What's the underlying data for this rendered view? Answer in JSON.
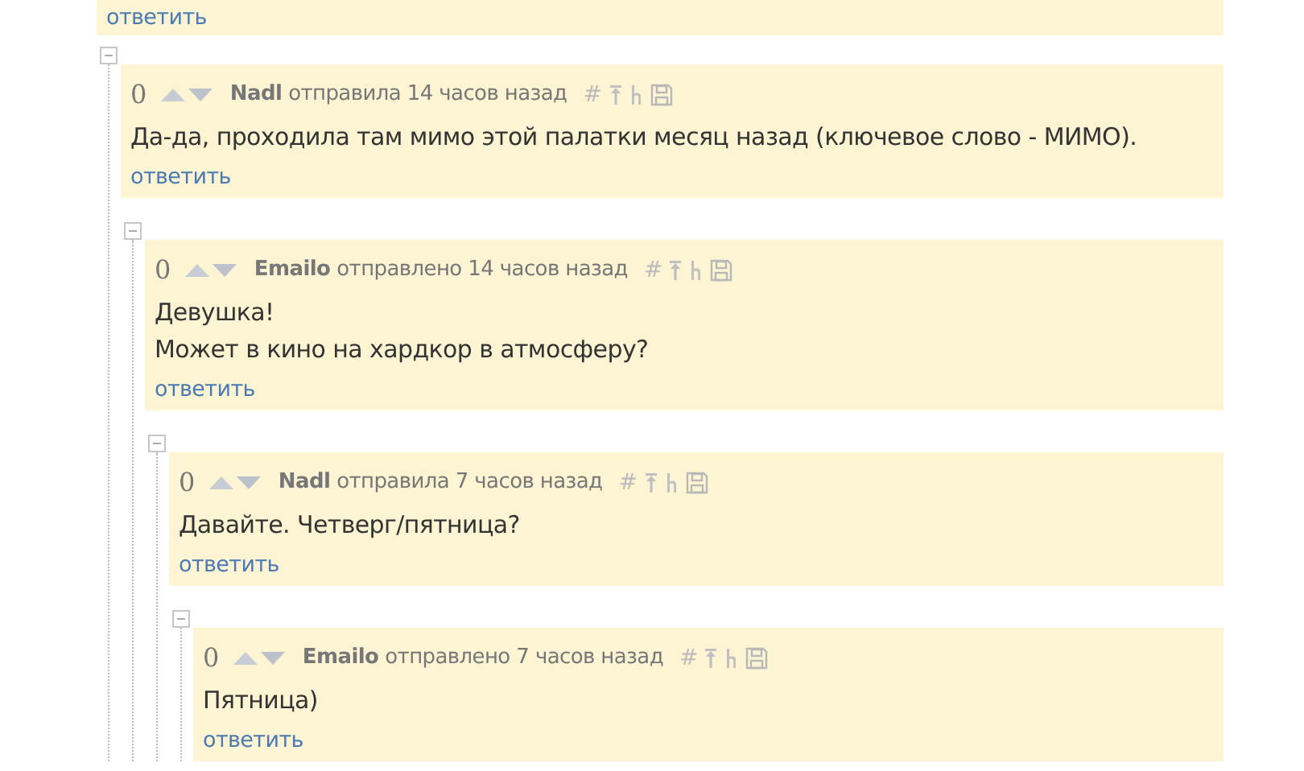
{
  "top_comment": {
    "reply_link": "ответить"
  },
  "comments": [
    {
      "expanded": true,
      "score": "0",
      "author": "Nadl",
      "action": "отправила",
      "time": "14 часов назад",
      "permalink": "#",
      "text": [
        "Да-да, проходила там мимо этой палатки месяц назад (ключевое слово - МИМО)."
      ],
      "reply_link": "ответить",
      "children": [
        {
          "expanded": true,
          "score": "0",
          "author": "Emailo",
          "action": "отправлено",
          "time": "14 часов назад",
          "permalink": "#",
          "text": [
            "Девушка!",
            "Может в кино на хардкор в атмосферу?"
          ],
          "reply_link": "ответить",
          "children": [
            {
              "expanded": true,
              "score": "0",
              "author": "Nadl",
              "action": "отправила",
              "time": "7 часов назад",
              "permalink": "#",
              "text": [
                "Давайте. Четверг/пятница?"
              ],
              "reply_link": "ответить",
              "children": [
                {
                  "expanded": true,
                  "score": "0",
                  "author": "Emailo",
                  "action": "отправлено",
                  "time": "7 часов назад",
                  "permalink": "#",
                  "text": [
                    "Пятница)"
                  ],
                  "reply_link": "ответить"
                }
              ]
            }
          ]
        }
      ]
    }
  ]
}
